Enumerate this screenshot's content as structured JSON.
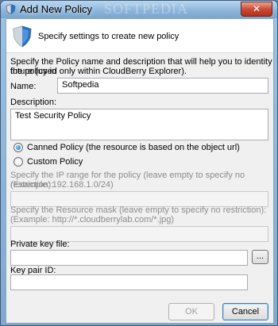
{
  "window": {
    "title": "Add New Policy",
    "watermark": "SOFTPEDIA",
    "close_label": "✕"
  },
  "header": {
    "text": "Specify settings to create new policy"
  },
  "intro": {
    "line1": "Specify the Policy name and description that will help you to identity the policy in",
    "line2": "future (used only within CloudBerry Explorer)."
  },
  "form": {
    "name_label": "Name:",
    "name_value": "Softpedia",
    "description_label": "Description:",
    "description_value": "Test Security Policy",
    "canned_policy_label": "Canned Policy (the resource is based on the object url)",
    "custom_policy_label": "Custom Policy",
    "selected_policy": "Canned Policy",
    "ip_hint_line1": "Specify the IP range for the policy (leave empty to specify no restriction):",
    "ip_hint_line2": "(Example: 192.168.1.0/24)",
    "ip_value": "",
    "resource_hint_line1": "Specify the Resource mask (leave empty to specify no restriction):",
    "resource_hint_line2": "(Example: http://*.cloudberrylab.com/*.jpg)",
    "resource_value": "",
    "private_key_label": "Private key file:",
    "private_key_value": "",
    "browse_label": "...",
    "key_pair_label": "Key pair ID:",
    "key_pair_value": ""
  },
  "buttons": {
    "ok": "OK",
    "cancel": "Cancel"
  }
}
